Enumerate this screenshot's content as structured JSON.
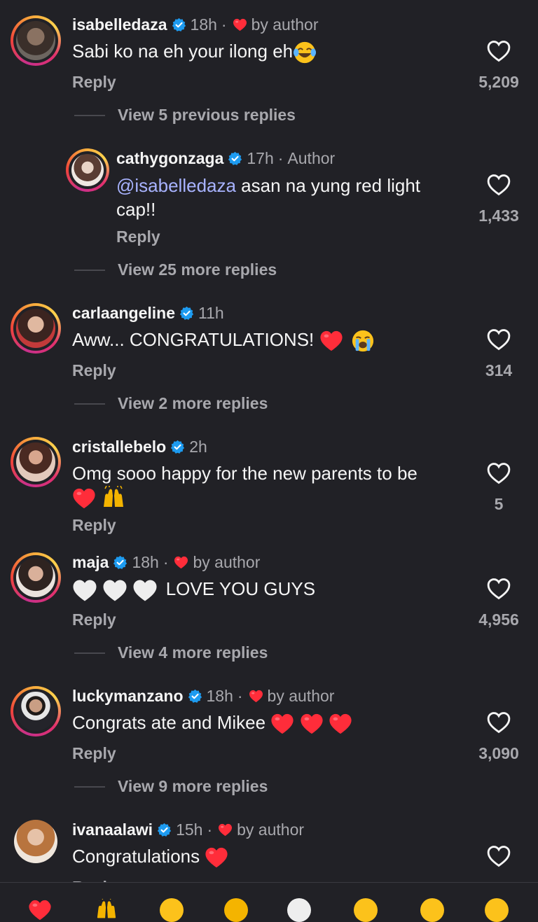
{
  "colors": {
    "background": "#212126",
    "primary_text": "#f5f5f5",
    "secondary_text": "#a8a8ad",
    "mention": "#a8b3ff",
    "verified_blue": "#1d9bf0",
    "heart_red": "#ff2d3a"
  },
  "comments": [
    {
      "username": "isabelledaza",
      "time": "18h",
      "separator": "·",
      "author_liked": "by author",
      "text": "Sabi ko na eh your ilong eh",
      "emoji": "joy-emoji",
      "reply_label": "Reply",
      "likes": "5,209",
      "view_replies": "View 5 previous replies"
    },
    {
      "username": "cathygonzaga",
      "time": "17h",
      "separator": "·",
      "author_tag": "Author",
      "mention": "@isabelledaza",
      "text_line1": " asan na yung red light",
      "text_line2": "cap!!",
      "reply_label": "Reply",
      "likes": "1,433",
      "view_replies": "View 25 more replies"
    },
    {
      "username": "carlaangeline",
      "time": "11h",
      "text": "Aww... CONGRATULATIONS! ",
      "emoji": "red-heart-and-crying-emoji",
      "reply_label": "Reply",
      "likes": "314",
      "view_replies": "View 2 more replies"
    },
    {
      "username": "cristallebelo",
      "time": "2h",
      "text_line1": "Omg sooo happy for the new parents to be",
      "emoji": "red-heart-and-raised-hands-emoji",
      "reply_label": "Reply",
      "likes": "5"
    },
    {
      "username": "maja",
      "time": "18h",
      "separator": "·",
      "author_liked": "by author",
      "text": "LOVE YOU GUYS",
      "emoji": "white-hearts-emoji",
      "reply_label": "Reply",
      "likes": "4,956",
      "view_replies": "View 4 more replies"
    },
    {
      "username": "luckymanzano",
      "time": "18h",
      "separator": "·",
      "author_liked": "by author",
      "text": "Congrats ate and Mikee ",
      "emoji": "three-red-hearts-emoji",
      "reply_label": "Reply",
      "likes": "3,090",
      "view_replies": "View 9 more replies"
    },
    {
      "username": "ivanaalawi",
      "time": "15h",
      "separator": "·",
      "author_liked": "by author",
      "text": "Congratulations ",
      "emoji": "red-heart-emoji",
      "reply_label": "Reply"
    }
  ],
  "bottom_bar": {
    "emojis": [
      "red-heart-emoji",
      "raised-hands-emoji",
      "fire-emoji",
      "clap-emoji",
      "crying-emoji",
      "heart-eyes-emoji",
      "open-mouth-emoji",
      "joy-emoji"
    ]
  }
}
